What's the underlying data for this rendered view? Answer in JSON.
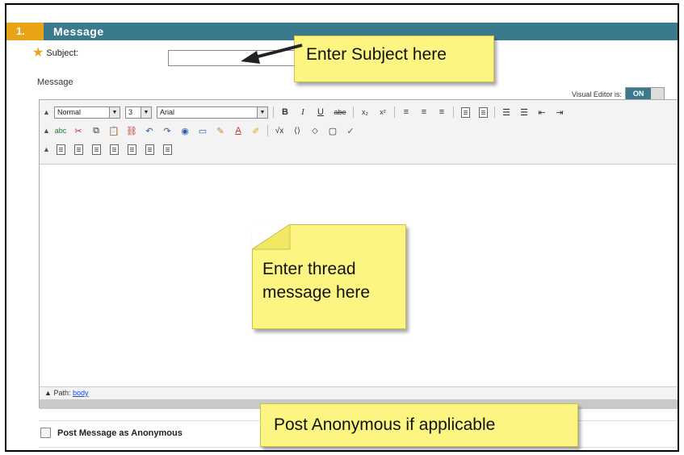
{
  "section": {
    "step_number": "1.",
    "title": "Message"
  },
  "subject": {
    "label": "Subject:",
    "required_marker": "★",
    "value": ""
  },
  "message": {
    "label": "Message"
  },
  "visual_editor": {
    "label": "Visual Editor is:",
    "state": "ON"
  },
  "toolbar": {
    "row1": {
      "format_select": "Normal",
      "size_select": "3",
      "font_select": "Arial",
      "buttons": [
        "B",
        "I",
        "U",
        "abe",
        "x₂",
        "x²"
      ]
    }
  },
  "path_bar": {
    "label": "Path:",
    "link": "body"
  },
  "anonymous": {
    "label": "Post Message as Anonymous"
  },
  "callouts": {
    "subject": "Enter Subject here",
    "message_line1": "Enter thread",
    "message_line2": "message here",
    "anonymous": "Post Anonymous if applicable"
  },
  "colors": {
    "header_bar": "#3a7a8c",
    "step_badge": "#e8a317",
    "callout_fill": "#fdf582",
    "toggle_on": "#3a7a8c"
  },
  "icons": [
    "required-star-icon",
    "collapse-icon",
    "bold-icon",
    "italic-icon",
    "underline-icon",
    "strikethrough-icon",
    "subscript-icon",
    "superscript-icon",
    "align-left-icon",
    "align-center-icon",
    "align-right-icon",
    "bulleted-list-icon",
    "numbered-list-icon",
    "outdent-icon",
    "indent-icon",
    "spellcheck-icon",
    "cut-icon",
    "copy-icon",
    "paste-icon",
    "unlink-icon",
    "undo-icon",
    "redo-icon",
    "globe-icon",
    "table-icon",
    "highlight-icon",
    "text-color-icon",
    "background-color-icon",
    "math-icon",
    "html-icon",
    "fullscreen-icon",
    "preview-icon"
  ]
}
